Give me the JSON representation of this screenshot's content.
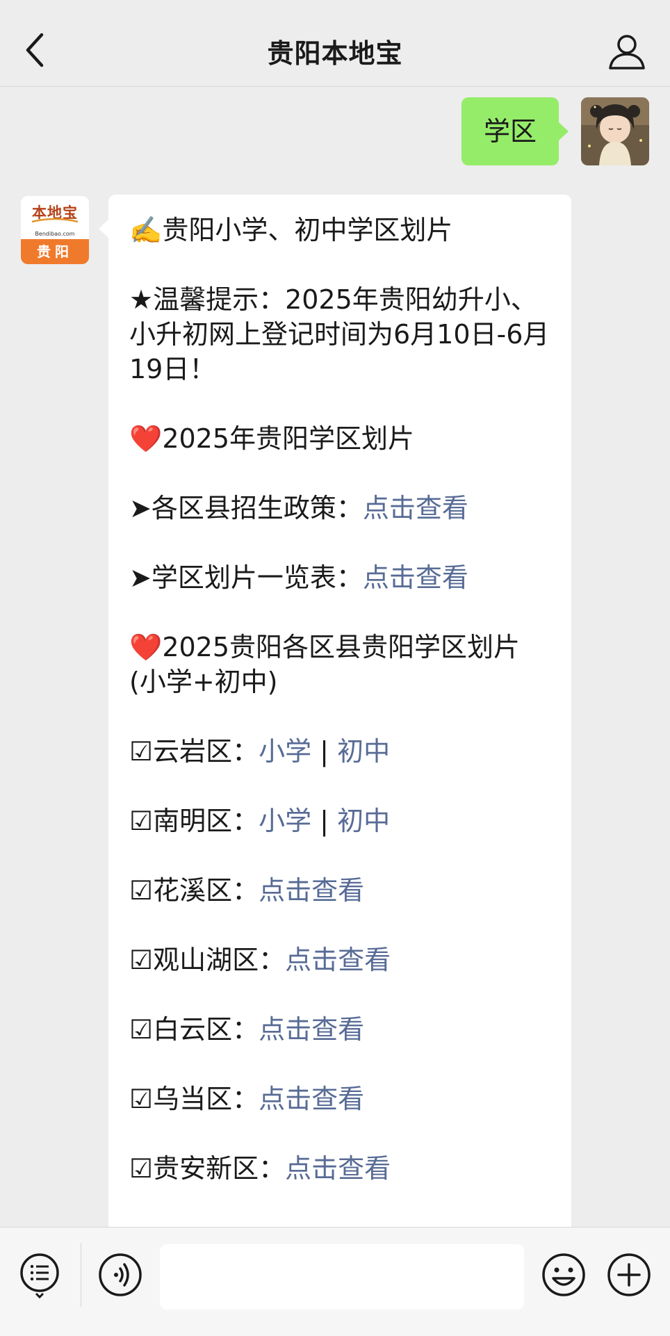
{
  "header": {
    "title": "贵阳本地宝"
  },
  "outgoing": {
    "text": "学区"
  },
  "official_avatar": {
    "logo_text": "本地宝",
    "logo_sub": "Bendibao.com",
    "city": "贵阳"
  },
  "message": {
    "title": "✍️贵阳小学、初中学区划片",
    "tip": "★温馨提示：2025年贵阳幼升小、小升初网上登记时间为6月10日-6月19日！",
    "heart": "❤️",
    "section1": "2025年贵阳学区划片",
    "policy_label": "➤各区县招生政策：",
    "policy_link": "点击查看",
    "table_label": "➤学区划片一览表：",
    "table_link": "点击查看",
    "section2": "2025贵阳各区县贵阳学区划片(小学+初中)",
    "separator": " | ",
    "districts": [
      {
        "label": "☑云岩区：",
        "link1": "小学",
        "link2": "初中"
      },
      {
        "label": "☑南明区：",
        "link1": "小学",
        "link2": "初中"
      },
      {
        "label": "☑花溪区：",
        "link": "点击查看"
      },
      {
        "label": "☑观山湖区：",
        "link": "点击查看"
      },
      {
        "label": "☑白云区：",
        "link": "点击查看"
      },
      {
        "label": "☑乌当区：",
        "link": "点击查看"
      },
      {
        "label": "☑贵安新区：",
        "link": "点击查看"
      }
    ]
  },
  "colors": {
    "link": "#576b95",
    "outgoing_bubble": "#95ec69",
    "background": "#ededed"
  },
  "icons": [
    "back-icon",
    "profile-icon",
    "menu-icon",
    "voice-icon",
    "emoji-icon",
    "plus-icon"
  ]
}
